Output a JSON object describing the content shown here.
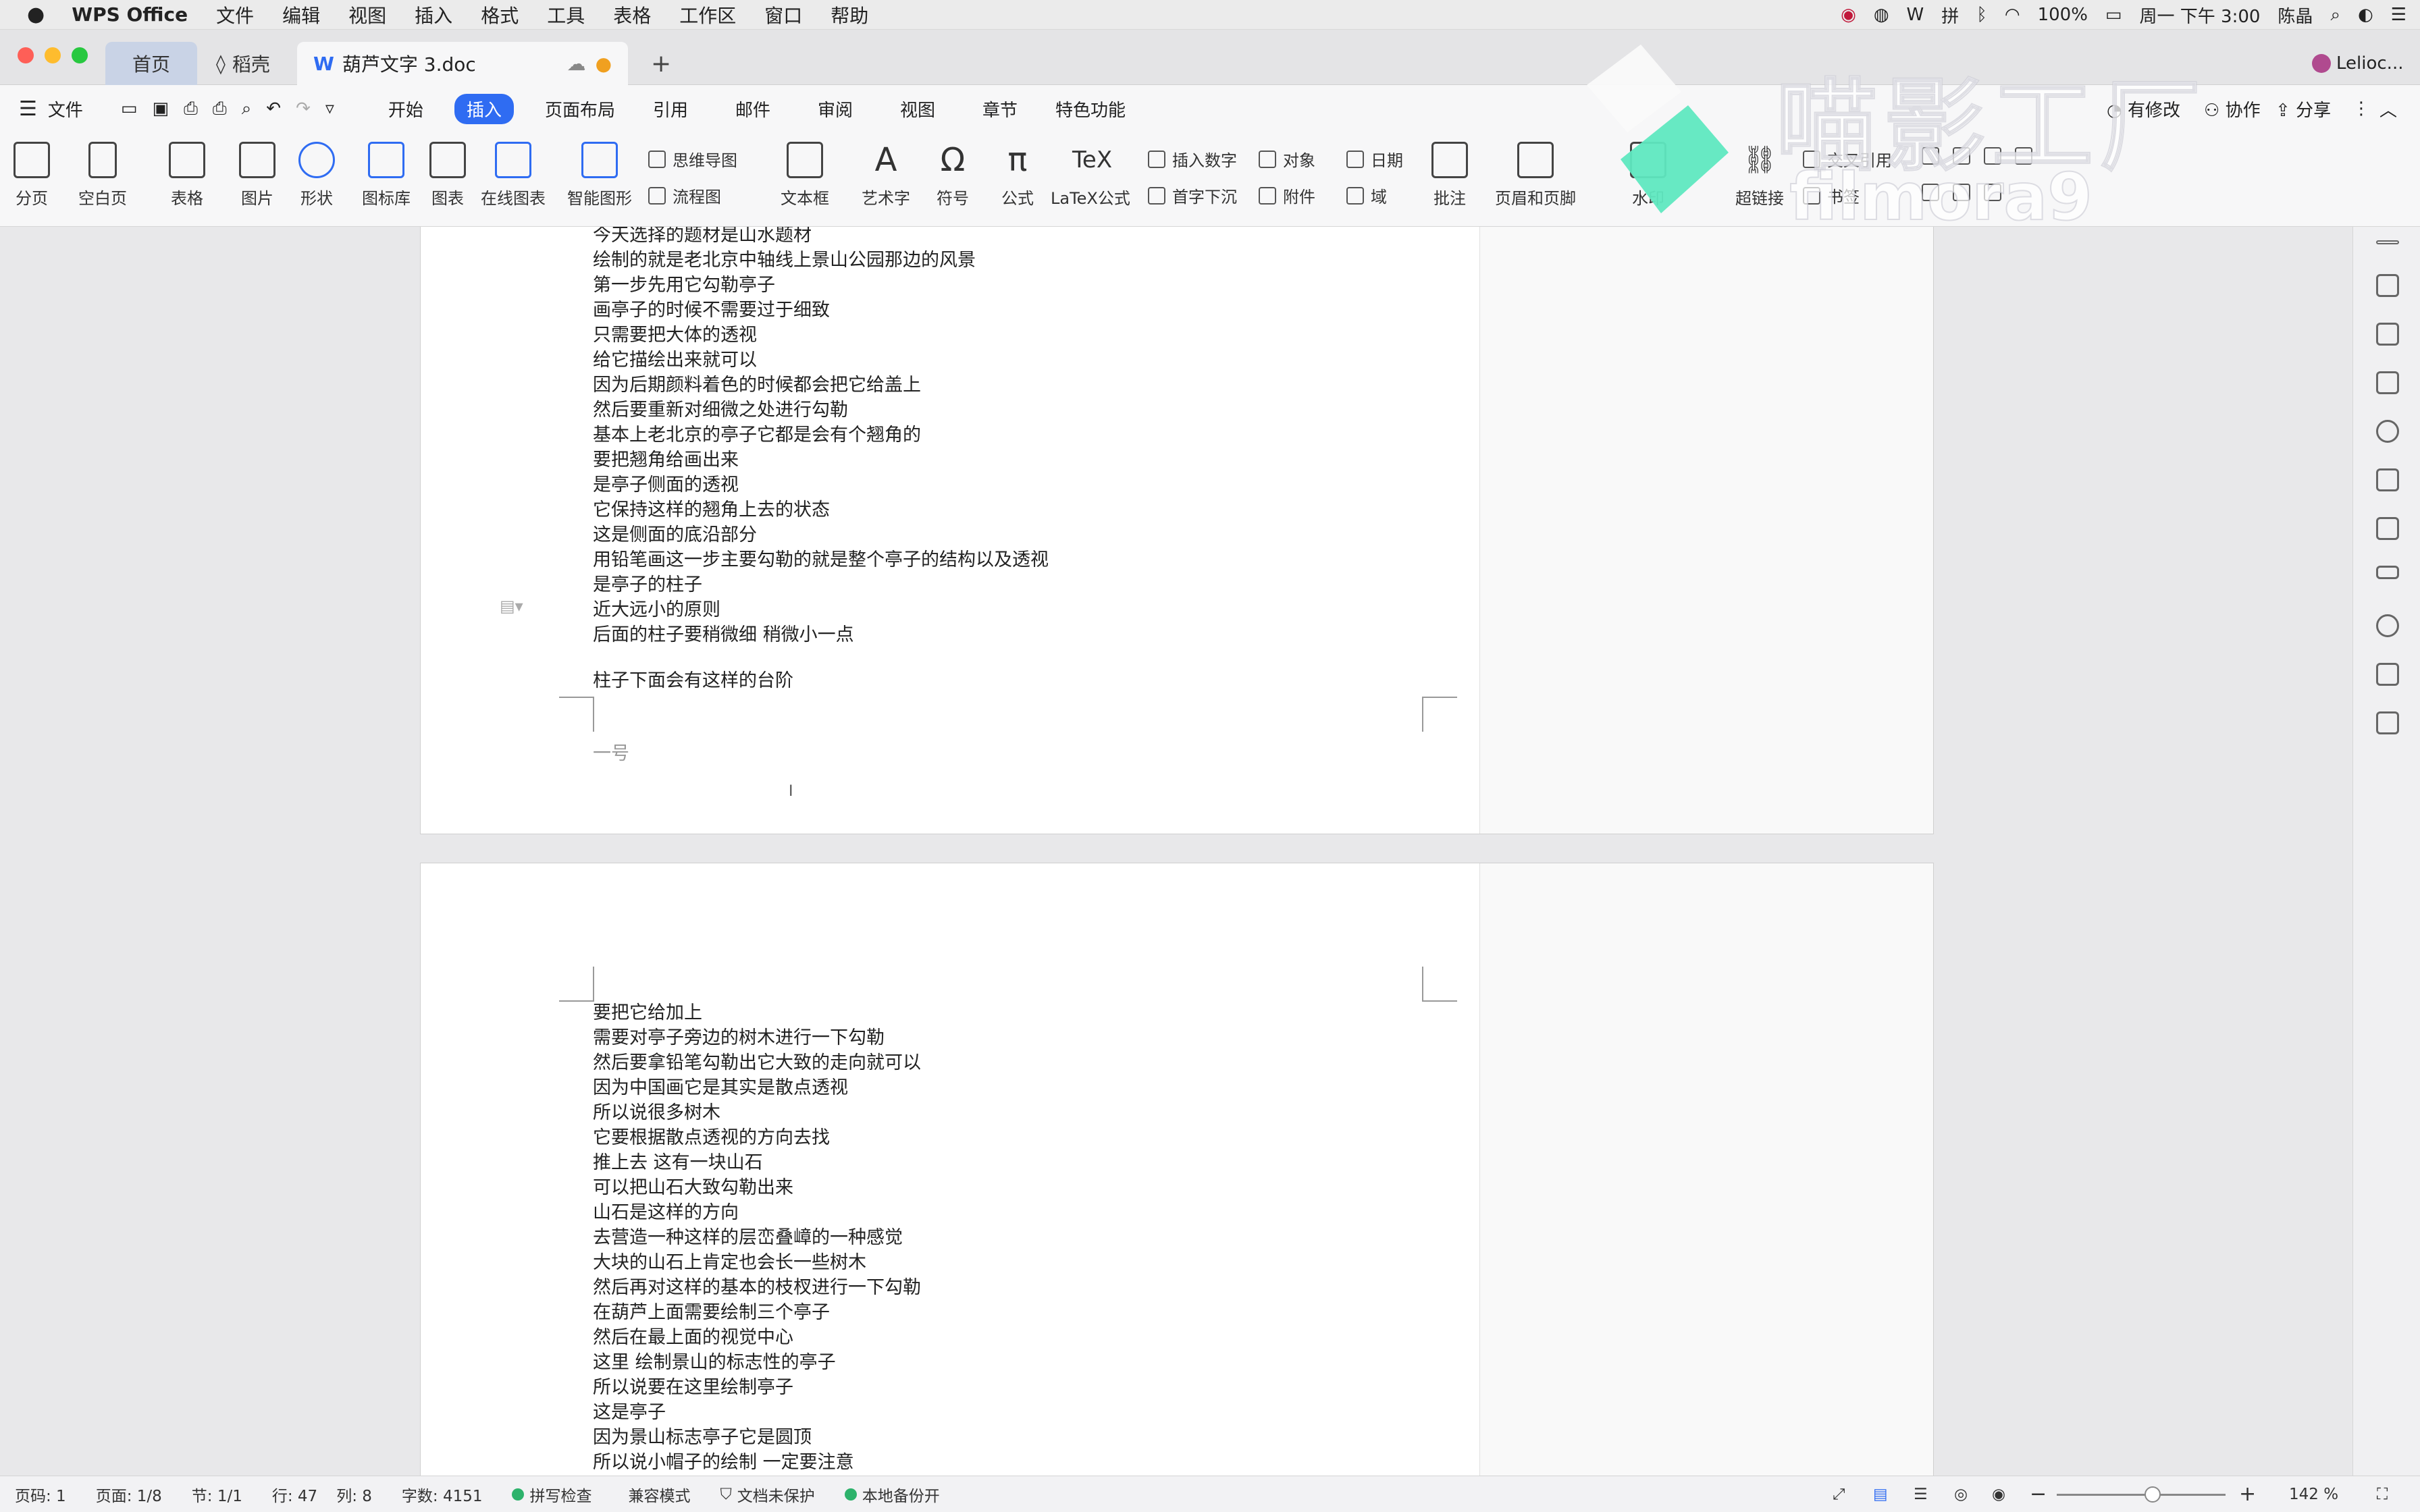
{
  "menubar": {
    "app": "WPS Office",
    "items": [
      "文件",
      "编辑",
      "视图",
      "插入",
      "格式",
      "工具",
      "表格",
      "工作区",
      "窗口",
      "帮助"
    ],
    "battery": "100%",
    "clock": "周一 下午 3:00",
    "user": "陈晶"
  },
  "tabs": {
    "home": "首页",
    "daoke": "稻壳",
    "doc": "葫芦文字 3.doc",
    "account": "Lelioc..."
  },
  "cmdrow": {
    "file": "文件",
    "tabs": [
      "开始",
      "插入",
      "页面布局",
      "引用",
      "邮件",
      "审阅",
      "视图",
      "章节",
      "特色功能"
    ],
    "active": "插入",
    "modified": "有修改",
    "collab": "协作",
    "share": "分享"
  },
  "ribbon": {
    "big": [
      "分页",
      "空白页",
      "表格",
      "图片",
      "形状",
      "图标库",
      "图表",
      "在线图表",
      "智能图形"
    ],
    "mindmap": "思维导图",
    "flow": "流程图",
    "textbox": "文本框",
    "art": "艺术字",
    "symbol": "符号",
    "formula": "公式",
    "latex": "LaTeX公式",
    "insnum": "插入数字",
    "dropcap": "首字下沉",
    "object": "对象",
    "attach": "附件",
    "date": "日期",
    "field": "域",
    "comment": "批注",
    "header": "页眉和页脚",
    "watermark": "水印",
    "hyperlink": "超链接",
    "crossref": "交叉引用",
    "bookmark": "书签"
  },
  "page1": {
    "lines": [
      "今天选择的题材是山水题材",
      "绘制的就是老北京中轴线上景山公园那边的风景",
      "第一步先用它勾勒亭子",
      "画亭子的时候不需要过于细致",
      "只需要把大体的透视",
      "给它描绘出来就可以",
      "因为后期颜料着色的时候都会把它给盖上",
      "然后要重新对细微之处进行勾勒",
      "基本上老北京的亭子它都是会有个翘角的",
      "要把翘角给画出来",
      "是亭子侧面的透视",
      "它保持这样的翘角上去的状态",
      "这是侧面的底沿部分",
      "用铅笔画这一步主要勾勒的就是整个亭子的结构以及透视",
      "是亭子的柱子",
      "近大远小的原则",
      "后面的柱子要稍微细  稍微小一点"
    ],
    "lastline": "柱子下面会有这样的台阶",
    "footer": "一号"
  },
  "page2": {
    "lines": [
      "要把它给加上",
      "需要对亭子旁边的树木进行一下勾勒",
      "然后要拿铅笔勾勒出它大致的走向就可以",
      "因为中国画它是其实是散点透视",
      "所以说很多树木",
      "它要根据散点透视的方向去找",
      "推上去  这有一块山石",
      "可以把山石大致勾勒出来",
      "山石是这样的方向",
      "去营造一种这样的层峦叠嶂的一种感觉",
      "大块的山石上肯定也会长一些树木",
      "然后再对这样的基本的枝杈进行一下勾勒",
      "在葫芦上面需要绘制三个亭子",
      "然后在最上面的视觉中心",
      "这里  绘制景山的标志性的亭子",
      "所以说要在这里绘制亭子",
      "这是亭子",
      "因为景山标志亭子它是圆顶",
      "所以说小帽子的绘制  一定要注意"
    ]
  },
  "status": {
    "page": "页码: 1",
    "pages": "页面: 1/8",
    "section": "节: 1/1",
    "row": "行: 47",
    "col": "列: 8",
    "words": "字数: 4151",
    "spell": "拼写检查",
    "compat": "兼容模式",
    "protect": "文档未保护",
    "backup": "本地备份开",
    "zoom": "142 %"
  },
  "watermark_text": {
    "cn": "喵影工厂",
    "en": "filmora9"
  }
}
